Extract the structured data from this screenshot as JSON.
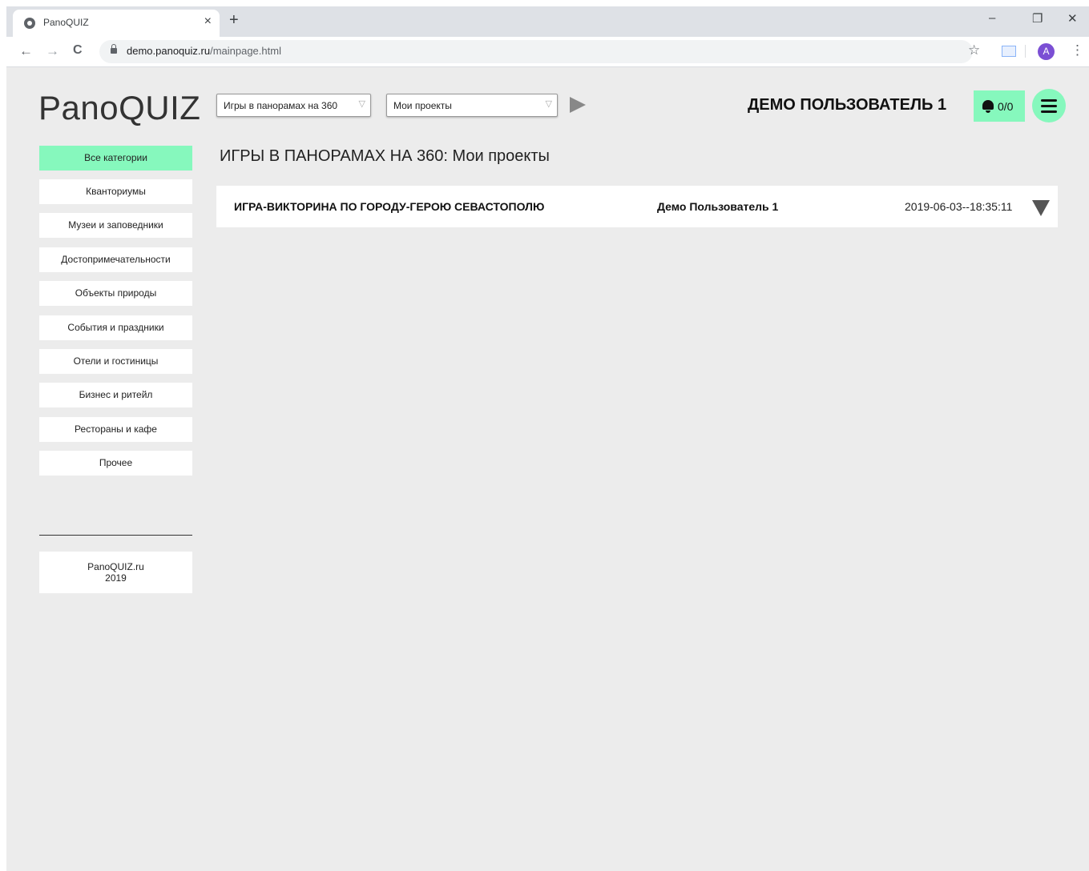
{
  "browser": {
    "tab_title": "PanoQUIZ",
    "tab_close": "×",
    "new_tab": "+",
    "win_minimize": "–",
    "win_restore": "❐",
    "win_close": "✕",
    "back": "←",
    "forward": "→",
    "reload": "C",
    "url_domain": "demo.panoquiz.ru",
    "url_path": "/mainpage.html",
    "star": "☆",
    "avatar": "A",
    "menu": "⋮"
  },
  "header": {
    "logo": "PanoQUIZ",
    "select_type": "Игры в панорамах на 360",
    "select_scope": "Мои проекты",
    "dropdown_glyph": "▽",
    "user_name": "ДЕМО ПОЛЬЗОВАТЕЛЬ 1",
    "notifications": "0/0"
  },
  "sidebar": {
    "items": [
      {
        "label": "Все категории"
      },
      {
        "label": "Кванториумы"
      },
      {
        "label": "Музеи и заповедники"
      },
      {
        "label": "Достопримечательности"
      },
      {
        "label": "Объекты природы"
      },
      {
        "label": "События и праздники"
      },
      {
        "label": "Отели и гостиницы"
      },
      {
        "label": "Бизнес и ритейл"
      },
      {
        "label": "Рестораны и кафе"
      },
      {
        "label": "Прочее"
      }
    ],
    "footer_site": "PanoQUIZ.ru",
    "footer_year": "2019"
  },
  "main": {
    "heading": "ИГРЫ В ПАНОРАМАХ НА 360: Мои проекты",
    "projects": [
      {
        "title": "ИГРА-ВИКТОРИНА ПО ГОРОДУ-ГЕРОЮ СЕВАСТОПОЛЮ",
        "author": "Демо Пользователь 1",
        "date": "2019-06-03--18:35:11"
      }
    ]
  },
  "colors": {
    "accent": "#86f8bd",
    "page_bg": "#ececec"
  }
}
